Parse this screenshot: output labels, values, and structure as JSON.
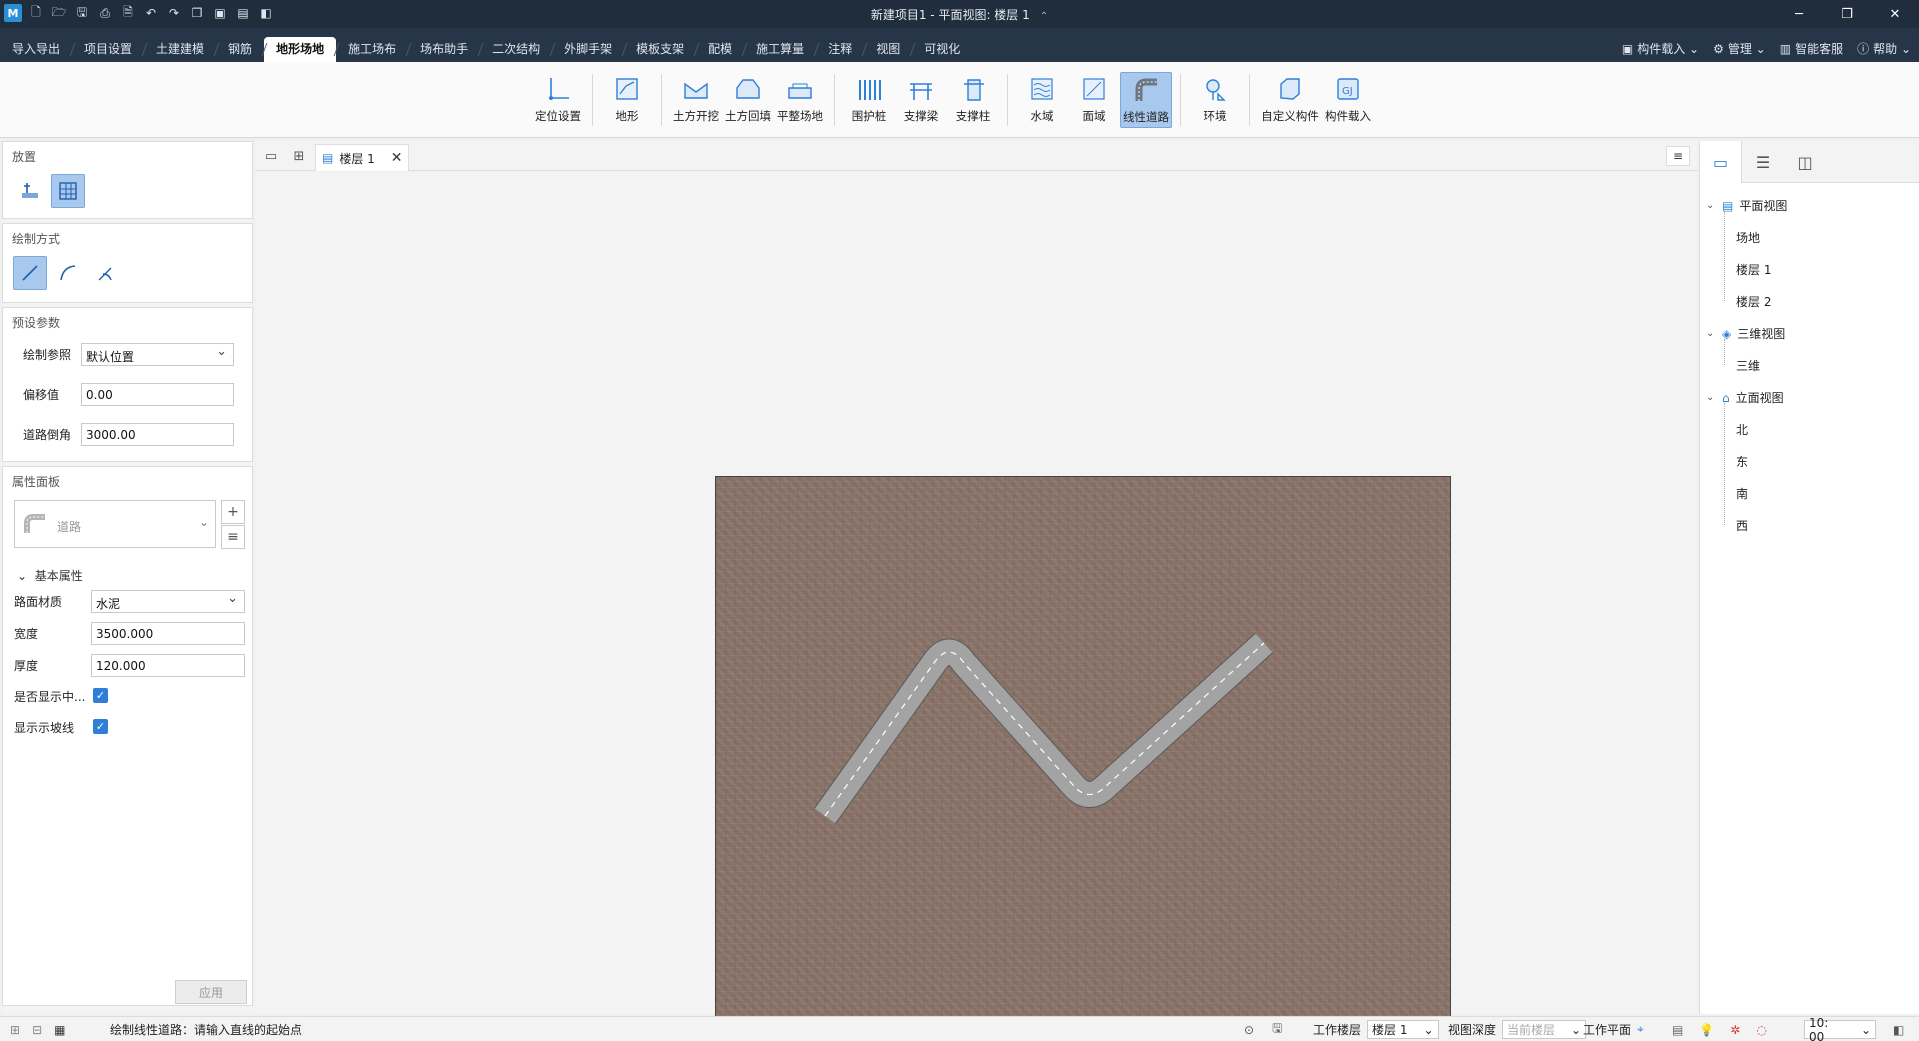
{
  "window": {
    "title": "新建项目1 - 平面视图: 楼层 1",
    "controls": [
      "minimize-icon",
      "restore-icon",
      "close-icon"
    ]
  },
  "quick_access": [
    "app-logo-icon",
    "new-file-icon",
    "open-folder-icon",
    "save-icon",
    "save-as-icon",
    "export-icon",
    "undo-icon",
    "redo-icon",
    "copy-icon",
    "paste-icon",
    "paste-special-icon",
    "cube-icon"
  ],
  "menu": {
    "tabs": [
      "导入导出",
      "项目设置",
      "土建建模",
      "钢筋",
      "地形场地",
      "施工场布",
      "场布助手",
      "二次结构",
      "外脚手架",
      "模板支架",
      "配模",
      "施工算量",
      "注释",
      "视图",
      "可视化"
    ],
    "active_tab": "地形场地",
    "right": {
      "component_load": "构件载入",
      "manage": "管理",
      "smart_service": "智能客服",
      "help": "帮助"
    }
  },
  "ribbon": {
    "buttons": [
      {
        "label": "定位设置",
        "icon": "axis-locate-icon"
      },
      {
        "label": "地形",
        "icon": "terrain-icon"
      },
      {
        "label": "土方开挖",
        "icon": "excavation-icon"
      },
      {
        "label": "土方回填",
        "icon": "backfill-icon"
      },
      {
        "label": "平整场地",
        "icon": "level-site-icon"
      },
      {
        "label": "围护桩",
        "icon": "retaining-pile-icon"
      },
      {
        "label": "支撑梁",
        "icon": "support-beam-icon"
      },
      {
        "label": "支撑柱",
        "icon": "support-column-icon"
      },
      {
        "label": "水域",
        "icon": "water-icon"
      },
      {
        "label": "面域",
        "icon": "region-icon"
      },
      {
        "label": "线性道路",
        "icon": "linear-road-icon"
      },
      {
        "label": "环境",
        "icon": "environment-tree-icon"
      },
      {
        "label": "自定义构件",
        "icon": "custom-component-icon"
      },
      {
        "label": "构件载入",
        "icon": "component-load-icon"
      }
    ],
    "active": "线性道路"
  },
  "left_panel": {
    "place": {
      "title": "放置"
    },
    "draw_mode": {
      "title": "绘制方式"
    },
    "preset": {
      "title": "预设参数",
      "draw_ref_label": "绘制参照",
      "draw_ref_value": "默认位置",
      "offset_label": "偏移值",
      "offset_value": "0.00",
      "chamfer_label": "道路倒角",
      "chamfer_value": "3000.00"
    },
    "props": {
      "title": "属性面板",
      "type_value": "道路",
      "group_label": "基本属性",
      "material_label": "路面材质",
      "material_value": "水泥",
      "width_label": "宽度",
      "width_value": "3500.000",
      "thickness_label": "厚度",
      "thickness_value": "120.000",
      "show_center_label": "是否显示中...",
      "show_center_checked": true,
      "show_slope_label": "显示示坡线",
      "show_slope_checked": true,
      "apply_label": "应用"
    }
  },
  "doc_tabs": {
    "active_tab": "楼层 1"
  },
  "project_tree": {
    "groups": [
      {
        "label": "平面视图",
        "items": [
          "场地",
          "楼层 1",
          "楼层 2"
        ]
      },
      {
        "label": "三维视图",
        "items": [
          "三维"
        ]
      },
      {
        "label": "立面视图",
        "items": [
          "北",
          "东",
          "南",
          "西"
        ]
      }
    ]
  },
  "status": {
    "prompt": "绘制线性道路：请输入直线的起始点",
    "work_floor_label": "工作楼层",
    "work_floor_value": "楼层 1",
    "view_depth_label": "视图深度",
    "view_depth_value": "当前楼层",
    "work_plane_label": "工作平面",
    "time_value": "10: 00"
  },
  "colors": {
    "title_bar": "#1f2d3d",
    "menu_bar": "#263648",
    "accent_selected": "#a8c8ee",
    "terrain": "#8a7469",
    "road": "#a3a3a3",
    "checkbox": "#2f7fd8"
  }
}
